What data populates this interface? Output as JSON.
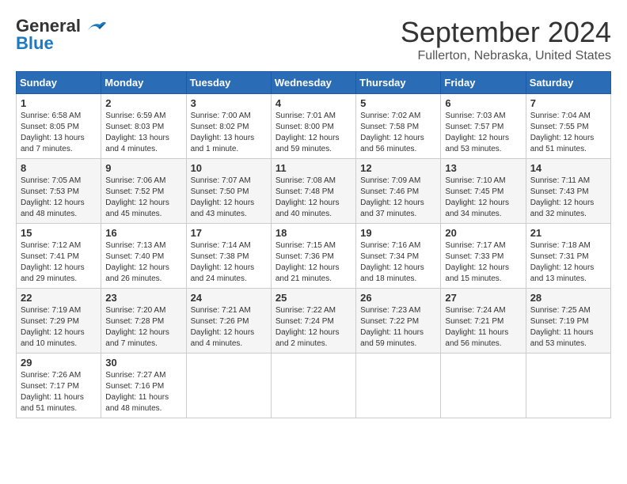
{
  "header": {
    "logo_line1": "General",
    "logo_line2": "Blue",
    "title": "September 2024",
    "subtitle": "Fullerton, Nebraska, United States"
  },
  "days_of_week": [
    "Sunday",
    "Monday",
    "Tuesday",
    "Wednesday",
    "Thursday",
    "Friday",
    "Saturday"
  ],
  "weeks": [
    [
      {
        "day": 1,
        "info": "Sunrise: 6:58 AM\nSunset: 8:05 PM\nDaylight: 13 hours and 7 minutes."
      },
      {
        "day": 2,
        "info": "Sunrise: 6:59 AM\nSunset: 8:03 PM\nDaylight: 13 hours and 4 minutes."
      },
      {
        "day": 3,
        "info": "Sunrise: 7:00 AM\nSunset: 8:02 PM\nDaylight: 13 hours and 1 minute."
      },
      {
        "day": 4,
        "info": "Sunrise: 7:01 AM\nSunset: 8:00 PM\nDaylight: 12 hours and 59 minutes."
      },
      {
        "day": 5,
        "info": "Sunrise: 7:02 AM\nSunset: 7:58 PM\nDaylight: 12 hours and 56 minutes."
      },
      {
        "day": 6,
        "info": "Sunrise: 7:03 AM\nSunset: 7:57 PM\nDaylight: 12 hours and 53 minutes."
      },
      {
        "day": 7,
        "info": "Sunrise: 7:04 AM\nSunset: 7:55 PM\nDaylight: 12 hours and 51 minutes."
      }
    ],
    [
      {
        "day": 8,
        "info": "Sunrise: 7:05 AM\nSunset: 7:53 PM\nDaylight: 12 hours and 48 minutes."
      },
      {
        "day": 9,
        "info": "Sunrise: 7:06 AM\nSunset: 7:52 PM\nDaylight: 12 hours and 45 minutes."
      },
      {
        "day": 10,
        "info": "Sunrise: 7:07 AM\nSunset: 7:50 PM\nDaylight: 12 hours and 43 minutes."
      },
      {
        "day": 11,
        "info": "Sunrise: 7:08 AM\nSunset: 7:48 PM\nDaylight: 12 hours and 40 minutes."
      },
      {
        "day": 12,
        "info": "Sunrise: 7:09 AM\nSunset: 7:46 PM\nDaylight: 12 hours and 37 minutes."
      },
      {
        "day": 13,
        "info": "Sunrise: 7:10 AM\nSunset: 7:45 PM\nDaylight: 12 hours and 34 minutes."
      },
      {
        "day": 14,
        "info": "Sunrise: 7:11 AM\nSunset: 7:43 PM\nDaylight: 12 hours and 32 minutes."
      }
    ],
    [
      {
        "day": 15,
        "info": "Sunrise: 7:12 AM\nSunset: 7:41 PM\nDaylight: 12 hours and 29 minutes."
      },
      {
        "day": 16,
        "info": "Sunrise: 7:13 AM\nSunset: 7:40 PM\nDaylight: 12 hours and 26 minutes."
      },
      {
        "day": 17,
        "info": "Sunrise: 7:14 AM\nSunset: 7:38 PM\nDaylight: 12 hours and 24 minutes."
      },
      {
        "day": 18,
        "info": "Sunrise: 7:15 AM\nSunset: 7:36 PM\nDaylight: 12 hours and 21 minutes."
      },
      {
        "day": 19,
        "info": "Sunrise: 7:16 AM\nSunset: 7:34 PM\nDaylight: 12 hours and 18 minutes."
      },
      {
        "day": 20,
        "info": "Sunrise: 7:17 AM\nSunset: 7:33 PM\nDaylight: 12 hours and 15 minutes."
      },
      {
        "day": 21,
        "info": "Sunrise: 7:18 AM\nSunset: 7:31 PM\nDaylight: 12 hours and 13 minutes."
      }
    ],
    [
      {
        "day": 22,
        "info": "Sunrise: 7:19 AM\nSunset: 7:29 PM\nDaylight: 12 hours and 10 minutes."
      },
      {
        "day": 23,
        "info": "Sunrise: 7:20 AM\nSunset: 7:28 PM\nDaylight: 12 hours and 7 minutes."
      },
      {
        "day": 24,
        "info": "Sunrise: 7:21 AM\nSunset: 7:26 PM\nDaylight: 12 hours and 4 minutes."
      },
      {
        "day": 25,
        "info": "Sunrise: 7:22 AM\nSunset: 7:24 PM\nDaylight: 12 hours and 2 minutes."
      },
      {
        "day": 26,
        "info": "Sunrise: 7:23 AM\nSunset: 7:22 PM\nDaylight: 11 hours and 59 minutes."
      },
      {
        "day": 27,
        "info": "Sunrise: 7:24 AM\nSunset: 7:21 PM\nDaylight: 11 hours and 56 minutes."
      },
      {
        "day": 28,
        "info": "Sunrise: 7:25 AM\nSunset: 7:19 PM\nDaylight: 11 hours and 53 minutes."
      }
    ],
    [
      {
        "day": 29,
        "info": "Sunrise: 7:26 AM\nSunset: 7:17 PM\nDaylight: 11 hours and 51 minutes."
      },
      {
        "day": 30,
        "info": "Sunrise: 7:27 AM\nSunset: 7:16 PM\nDaylight: 11 hours and 48 minutes."
      },
      null,
      null,
      null,
      null,
      null
    ]
  ]
}
